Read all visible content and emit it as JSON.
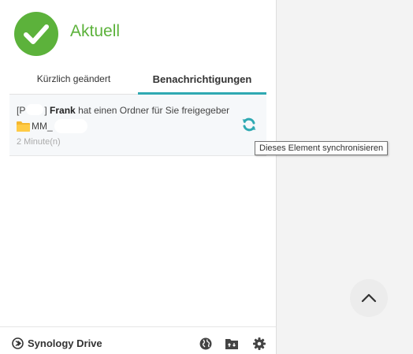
{
  "status": {
    "title": "Aktuell",
    "icon": "check-circle-icon",
    "color": "#5cb23b"
  },
  "tabs": [
    {
      "label": "Kürzlich geändert",
      "active": false
    },
    {
      "label": "Benachrichtigungen",
      "active": true
    }
  ],
  "accent_color": "#2fa9b2",
  "notification": {
    "prefix": "[P",
    "prefix_close": "]",
    "user": "Frank",
    "message": "hat einen Ordner für Sie freigegeber",
    "folder_name": "MM_",
    "time": "2 Minute(n)",
    "action_icon": "sync-icon"
  },
  "tooltip": "Dieses Element synchronisieren",
  "footer": {
    "brand": "Synology Drive",
    "icons": [
      "globe-icon",
      "drive-folder-icon",
      "gear-icon"
    ]
  },
  "scroll_top_icon": "chevron-up-icon"
}
